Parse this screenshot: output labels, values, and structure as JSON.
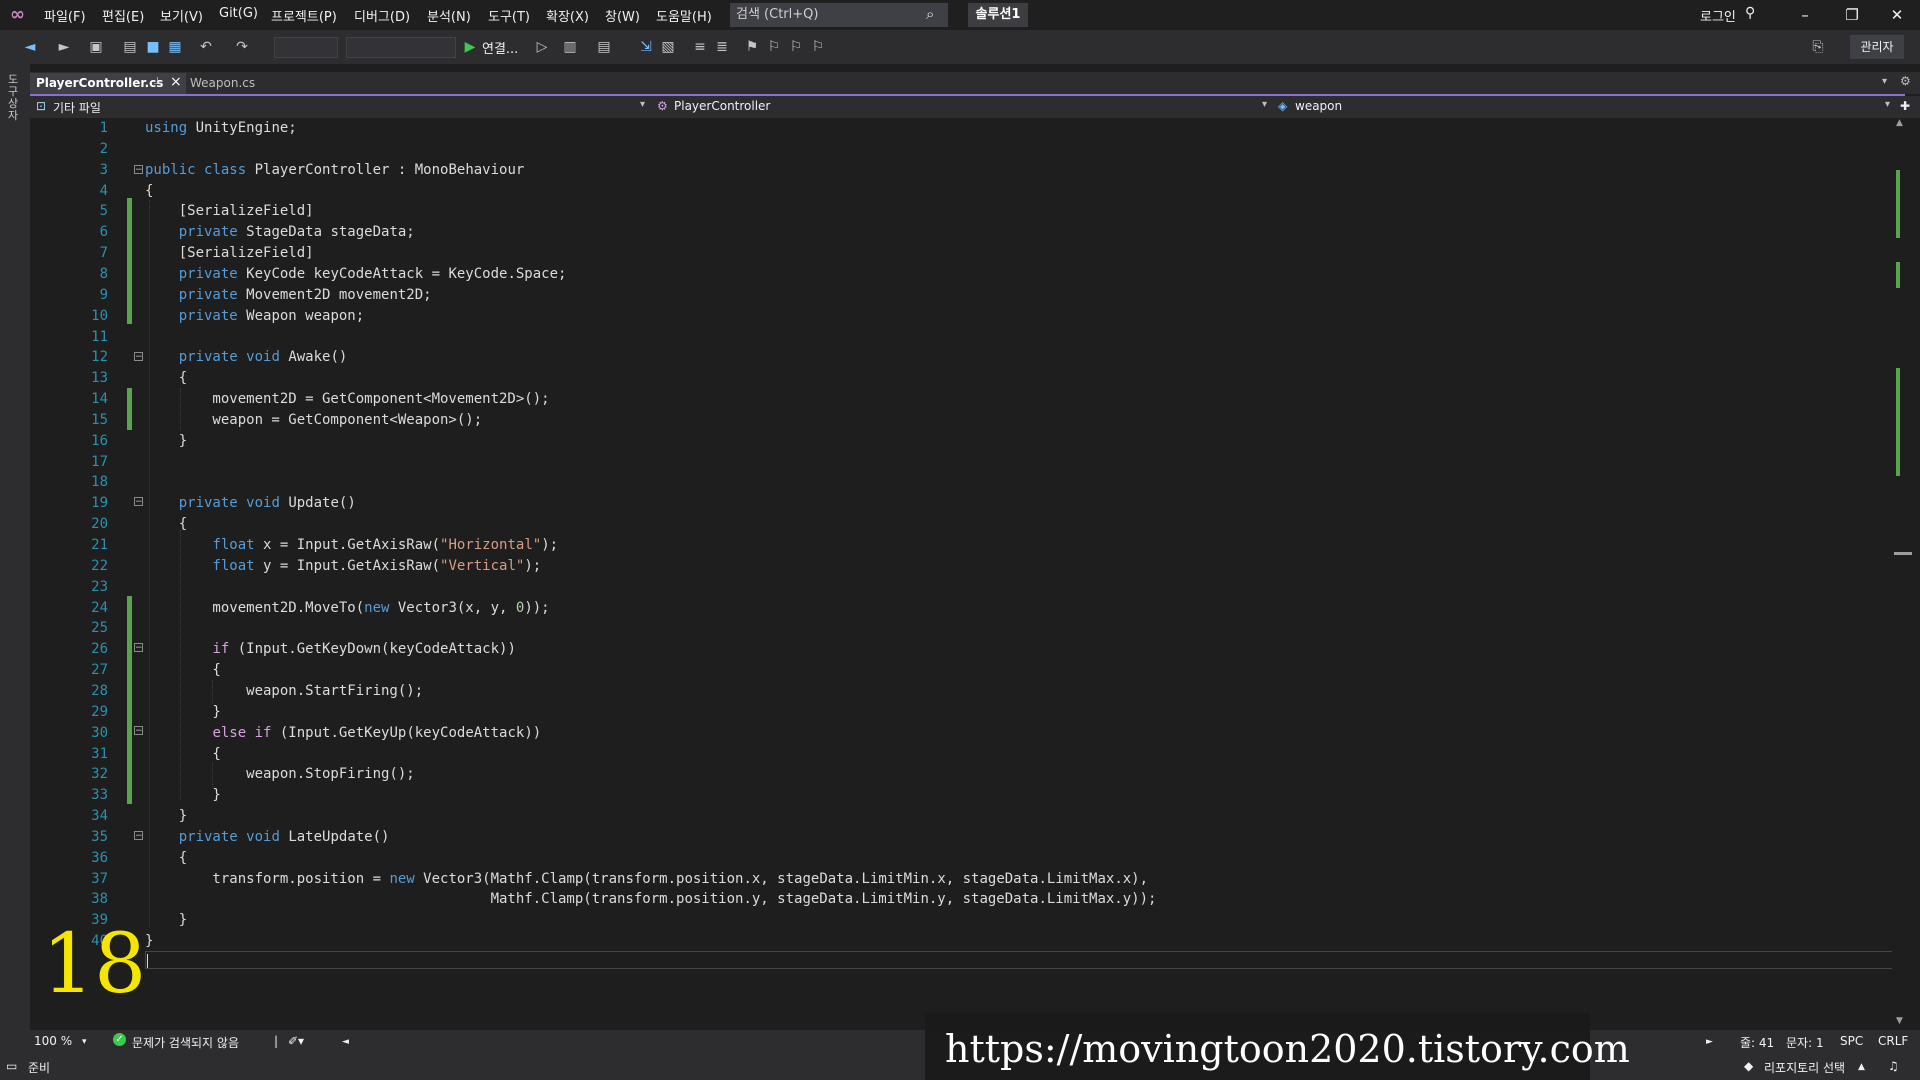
{
  "menu": {
    "items": [
      "파일(F)",
      "편집(E)",
      "보기(V)",
      "Git(G)",
      "프로젝트(P)",
      "디버그(D)",
      "분석(N)",
      "도구(T)",
      "확장(X)",
      "창(W)",
      "도움말(H)"
    ],
    "search_placeholder": "검색 (Ctrl+Q)",
    "solution": "솔루션1",
    "login": "로그인",
    "admin": "관리자"
  },
  "toolbar": {
    "run_label": "연결..."
  },
  "left_strip": {
    "label": "도구상자"
  },
  "tabs": {
    "active": "PlayerController.cs",
    "inactive": "Weapon.cs"
  },
  "navbar": {
    "project": "기타 파일",
    "class": "PlayerController",
    "member": "weapon"
  },
  "code": {
    "line_numbers": [
      "1",
      "2",
      "3",
      "4",
      "5",
      "6",
      "7",
      "8",
      "9",
      "10",
      "11",
      "12",
      "13",
      "14",
      "15",
      "16",
      "17",
      "18",
      "19",
      "20",
      "21",
      "22",
      "23",
      "24",
      "25",
      "26",
      "27",
      "28",
      "29",
      "30",
      "31",
      "32",
      "33",
      "34",
      "35",
      "36",
      "37",
      "38",
      "39",
      "40"
    ],
    "lines": [
      "using UnityEngine;",
      "",
      "public class PlayerController : MonoBehaviour",
      "{",
      "    [SerializeField]",
      "    private StageData stageData;",
      "    [SerializeField]",
      "    private KeyCode keyCodeAttack = KeyCode.Space;",
      "    private Movement2D movement2D;",
      "    private Weapon weapon;",
      "",
      "    private void Awake()",
      "    {",
      "        movement2D = GetComponent<Movement2D>();",
      "        weapon = GetComponent<Weapon>();",
      "    }",
      "",
      "",
      "    private void Update()",
      "    {",
      "        float x = Input.GetAxisRaw(\"Horizontal\");",
      "        float y = Input.GetAxisRaw(\"Vertical\");",
      "",
      "        movement2D.MoveTo(new Vector3(x, y, 0));",
      "",
      "        if (Input.GetKeyDown(keyCodeAttack))",
      "        {",
      "            weapon.StartFiring();",
      "        }",
      "        else if (Input.GetKeyUp(keyCodeAttack))",
      "        {",
      "            weapon.StopFiring();",
      "        }",
      "    }",
      "    private void LateUpdate()",
      "    {",
      "        transform.position = new Vector3(Mathf.Clamp(transform.position.x, stageData.LimitMin.x, stageData.LimitMax.x),",
      "                                         Mathf.Clamp(transform.position.y, stageData.LimitMin.y, stageData.LimitMax.y));",
      "    }",
      "}"
    ]
  },
  "footer": {
    "zoom": "100 %",
    "issues": "문제가 검색되지 않음",
    "line": "줄: 41",
    "char": "문자: 1",
    "spc": "SPC",
    "crlf": "CRLF"
  },
  "status": {
    "ready": "준비",
    "repo": "리포지토리 선택"
  },
  "overlay": {
    "episode": "18",
    "watermark": "https://movingtoon2020.tistory.com"
  },
  "colors": {
    "keyword": "#569cd6",
    "type": "#4ec9b0",
    "string": "#d69d85",
    "number": "#b5cea8",
    "control": "#d8a0df",
    "line_number": "#2b91af",
    "change_bar": "#57a64a",
    "accent": "#8b6fd6"
  }
}
